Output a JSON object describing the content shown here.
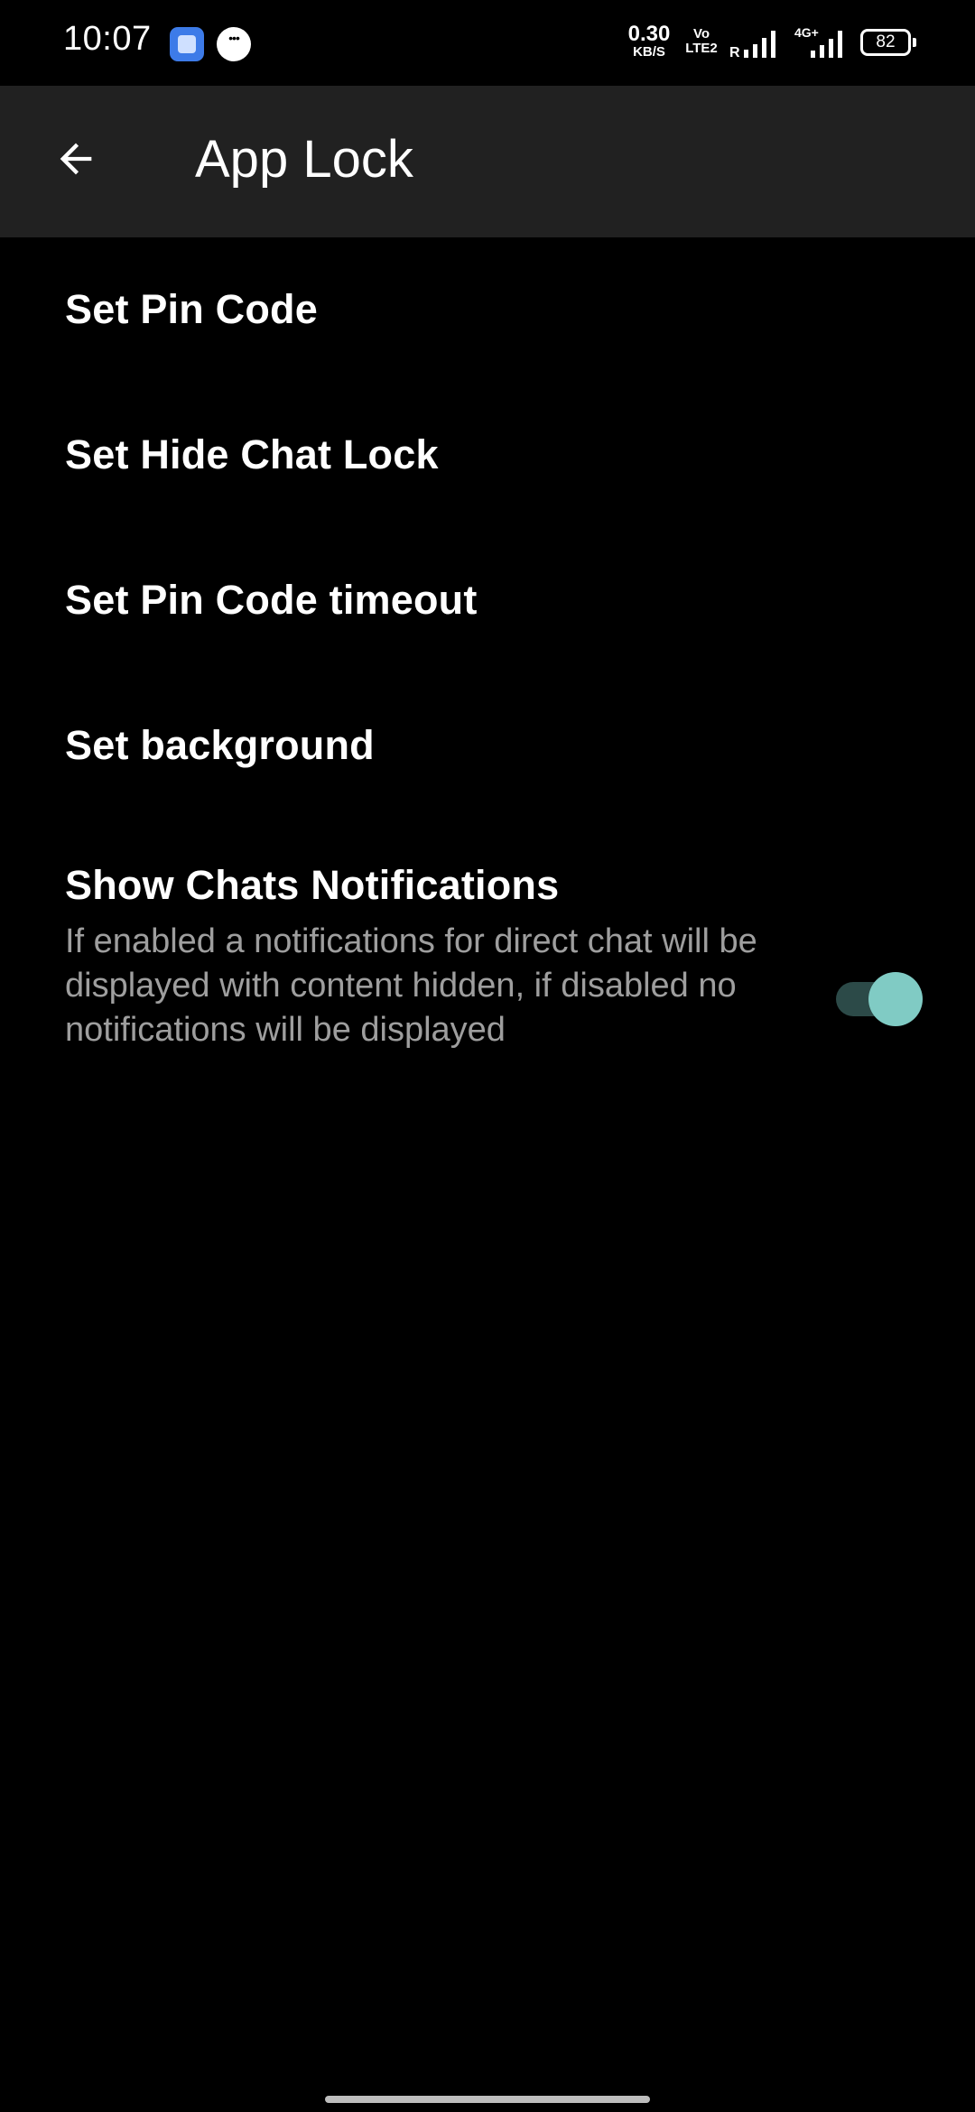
{
  "status_bar": {
    "time": "10:07",
    "net_speed_value": "0.30",
    "net_speed_unit": "KB/S",
    "volte_top": "Vo",
    "volte_bottom": "LTE2",
    "roaming": "R",
    "network_type": "4G+",
    "battery": "82",
    "icons": [
      "app-notification-icon",
      "message-notification-icon",
      "signal-icon",
      "signal-4g-icon",
      "battery-icon"
    ]
  },
  "app_bar": {
    "back_icon": "arrow-left-icon",
    "title": "App Lock"
  },
  "settings": [
    {
      "label": "Set Pin Code"
    },
    {
      "label": "Set Hide Chat Lock"
    },
    {
      "label": "Set Pin Code timeout"
    },
    {
      "label": "Set background"
    },
    {
      "label": "Show Chats Notifications",
      "summary": "If enabled a notifications for direct chat will be displayed with content hidden, if disabled no notifications will be displayed",
      "toggle_on": true
    }
  ],
  "colors": {
    "background": "#000000",
    "app_bar": "#212121",
    "accent": "#80cbc4",
    "toggle_track": "#2c4a48",
    "summary_text": "#9e9e9e"
  }
}
